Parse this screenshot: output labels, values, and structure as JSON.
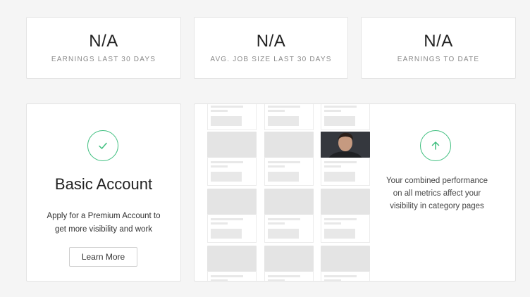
{
  "stats": [
    {
      "value": "N/A",
      "label": "EARNINGS LAST 30 DAYS"
    },
    {
      "value": "N/A",
      "label": "AVG. JOB SIZE LAST 30 DAYS"
    },
    {
      "value": "N/A",
      "label": "EARNINGS TO DATE"
    }
  ],
  "account": {
    "icon": "check-icon",
    "title": "Basic Account",
    "description_line1": "Apply for a Premium Account to",
    "description_line2": "get more visibility and work",
    "button_label": "Learn More"
  },
  "performance": {
    "icon": "arrow-up-icon",
    "line1": "Your combined performance",
    "line2": "on all metrics affect your",
    "line3": "visibility in category pages"
  },
  "colors": {
    "accent": "#3fbf7f",
    "page_bg": "#f5f5f5",
    "card_bg": "#ffffff",
    "placeholder": "#e4e4e4"
  }
}
